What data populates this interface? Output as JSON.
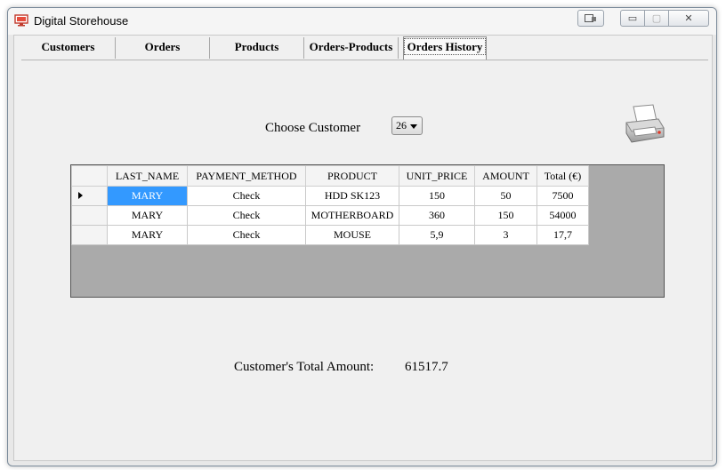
{
  "window": {
    "title": "Digital Storehouse",
    "minimize": "▭",
    "maximize": "▢",
    "close": "✕"
  },
  "tabs": [
    {
      "label": "Customers"
    },
    {
      "label": "Orders"
    },
    {
      "label": "Products"
    },
    {
      "label": "Orders-Products"
    },
    {
      "label": "Orders History"
    }
  ],
  "active_tab": "Orders History",
  "filter": {
    "label": "Choose Customer",
    "selected_value": "26"
  },
  "grid": {
    "columns": [
      "LAST_NAME",
      "PAYMENT_METHOD",
      "PRODUCT",
      "UNIT_PRICE",
      "AMOUNT",
      "Total (€)"
    ],
    "rows": [
      [
        "MARY",
        "Check",
        "HDD SK123",
        "150",
        "50",
        "7500"
      ],
      [
        "MARY",
        "Check",
        "MOTHERBOARD",
        "360",
        "150",
        "54000"
      ],
      [
        "MARY",
        "Check",
        "MOUSE",
        "5,9",
        "3",
        "17,7"
      ]
    ],
    "selected_row": 0
  },
  "summary": {
    "label": "Customer's Total Amount:",
    "value": "61517.7"
  },
  "colors": {
    "selection": "#3399ff",
    "grid_background": "#aaaaaa"
  },
  "icons": {
    "app": "computer-icon",
    "print": "printer-icon"
  }
}
